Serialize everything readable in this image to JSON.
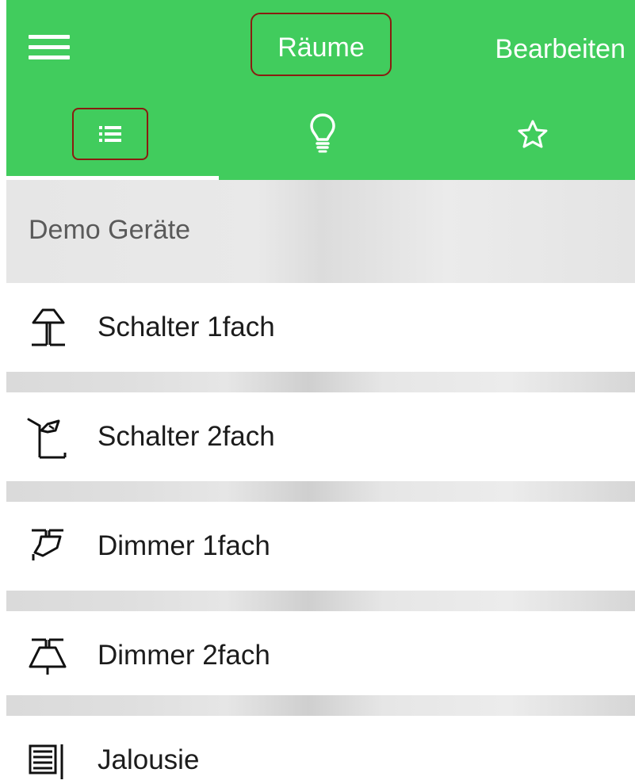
{
  "colors": {
    "accent": "#41cc5d",
    "highlight_box": "#8a1c10",
    "text_on_accent": "#ffffff",
    "item_text": "#1c1c1c",
    "section_text": "#5a5a5a"
  },
  "header": {
    "menu_icon": "hamburger-menu-icon",
    "title": "Räume",
    "edit_label": "Bearbeiten"
  },
  "tabs": [
    {
      "icon": "list-icon",
      "selected": true
    },
    {
      "icon": "lightbulb-icon",
      "selected": false
    },
    {
      "icon": "star-icon",
      "selected": false
    }
  ],
  "section": {
    "title": "Demo Geräte"
  },
  "devices": [
    {
      "label": "Schalter 1fach",
      "icon": "floor-lamp-icon"
    },
    {
      "label": "Schalter 2fach",
      "icon": "desk-lamp-icon"
    },
    {
      "label": "Dimmer 1fach",
      "icon": "ceiling-spot-icon"
    },
    {
      "label": "Dimmer 2fach",
      "icon": "pendant-lamp-icon"
    },
    {
      "label": "Jalousie",
      "icon": "blind-icon"
    }
  ]
}
